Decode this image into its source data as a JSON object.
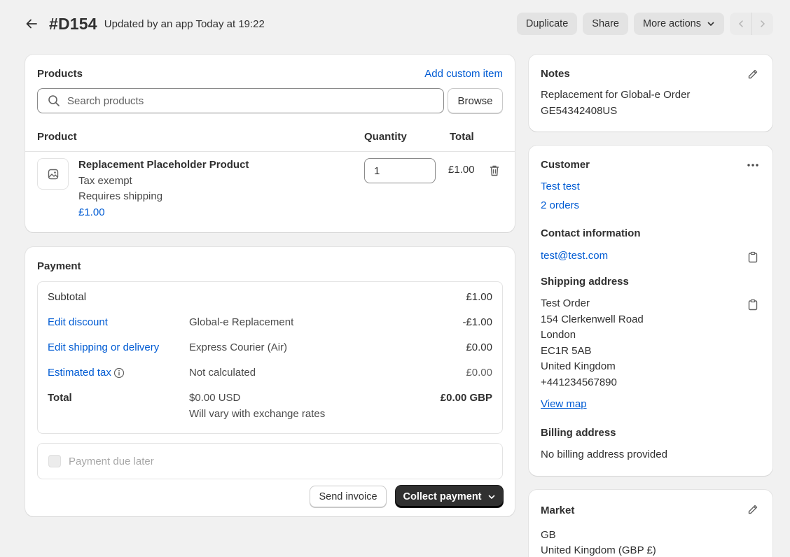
{
  "header": {
    "order_id": "#D154",
    "updated": "Updated by an app Today at 19:22",
    "duplicate": "Duplicate",
    "share": "Share",
    "more_actions": "More actions"
  },
  "products": {
    "title": "Products",
    "add_custom_item": "Add custom item",
    "search_placeholder": "Search products",
    "browse": "Browse",
    "columns": {
      "product": "Product",
      "quantity": "Quantity",
      "total": "Total"
    },
    "items": [
      {
        "name": "Replacement Placeholder Product",
        "tax": "Tax exempt",
        "shipping": "Requires shipping",
        "price": "£1.00",
        "quantity": "1",
        "total": "£1.00"
      }
    ]
  },
  "payment": {
    "title": "Payment",
    "rows": {
      "subtotal": {
        "label": "Subtotal",
        "value": "£1.00"
      },
      "discount": {
        "label": "Edit discount",
        "desc": "Global-e Replacement",
        "value": "-£1.00"
      },
      "shipping": {
        "label": "Edit shipping or delivery",
        "desc": "Express Courier (Air)",
        "value": "£0.00"
      },
      "tax": {
        "label": "Estimated tax",
        "desc": "Not calculated",
        "value": "£0.00"
      },
      "total": {
        "label": "Total",
        "desc": "$0.00 USD",
        "desc2": "Will vary with exchange rates",
        "value": "£0.00 GBP"
      }
    },
    "payment_due_later": "Payment due later",
    "send_invoice": "Send invoice",
    "collect_payment": "Collect payment"
  },
  "notes": {
    "title": "Notes",
    "line1": "Replacement for Global-e Order",
    "line2": "GE54342408US"
  },
  "customer": {
    "title": "Customer",
    "name": "Test test",
    "orders": "2 orders",
    "contact_title": "Contact information",
    "email": "test@test.com",
    "shipping_title": "Shipping address",
    "address": [
      "Test Order",
      "154 Clerkenwell Road",
      "London",
      "EC1R 5AB",
      "United Kingdom",
      "+441234567890"
    ],
    "view_map": "View map",
    "billing_title": "Billing address",
    "billing_text": "No billing address provided"
  },
  "market": {
    "title": "Market",
    "code": "GB",
    "country": "United Kingdom (GBP £)"
  }
}
